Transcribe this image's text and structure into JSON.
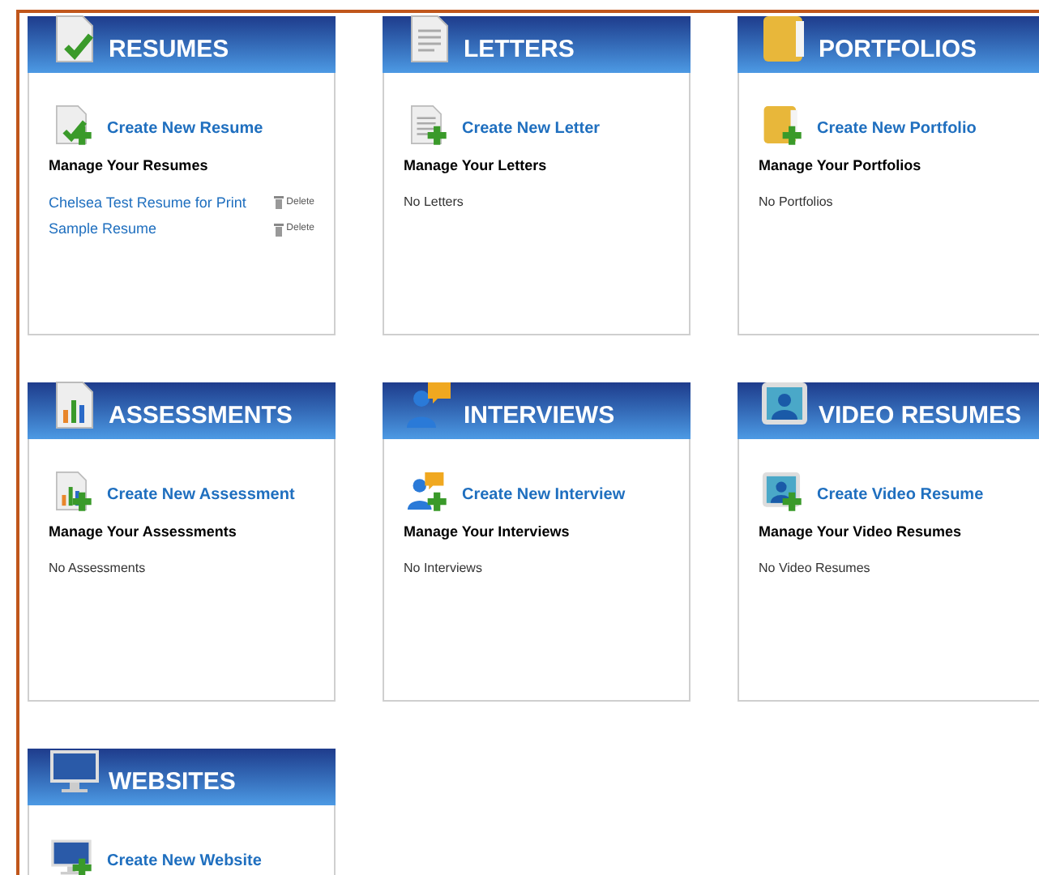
{
  "sections": [
    {
      "kind": "resume",
      "title": "RESUMES",
      "create_label": "Create New Resume",
      "manage_heading": "Manage Your Resumes",
      "items": [
        {
          "name": "Chelsea Test Resume for Print",
          "action": "Delete"
        },
        {
          "name": "Sample Resume",
          "action": "Delete"
        }
      ]
    },
    {
      "kind": "letter",
      "title": "LETTERS",
      "create_label": "Create New Letter",
      "manage_heading": "Manage Your Letters",
      "empty_text": "No Letters"
    },
    {
      "kind": "portfolio",
      "title": "PORTFOLIOS",
      "create_label": "Create New Portfolio",
      "manage_heading": "Manage Your Portfolios",
      "empty_text": "No Portfolios"
    },
    {
      "kind": "assessment",
      "title": "ASSESSMENTS",
      "create_label": "Create New Assessment",
      "manage_heading": "Manage Your Assessments",
      "empty_text": "No Assessments"
    },
    {
      "kind": "interview",
      "title": "INTERVIEWS",
      "create_label": "Create New Interview",
      "manage_heading": "Manage Your Interviews",
      "empty_text": "No Interviews"
    },
    {
      "kind": "video",
      "title": "VIDEO RESUMES",
      "create_label": "Create Video Resume",
      "manage_heading": "Manage Your Video Resumes",
      "empty_text": "No Video Resumes"
    },
    {
      "kind": "website",
      "title": "WEBSITES",
      "create_label": "Create New Website"
    }
  ]
}
